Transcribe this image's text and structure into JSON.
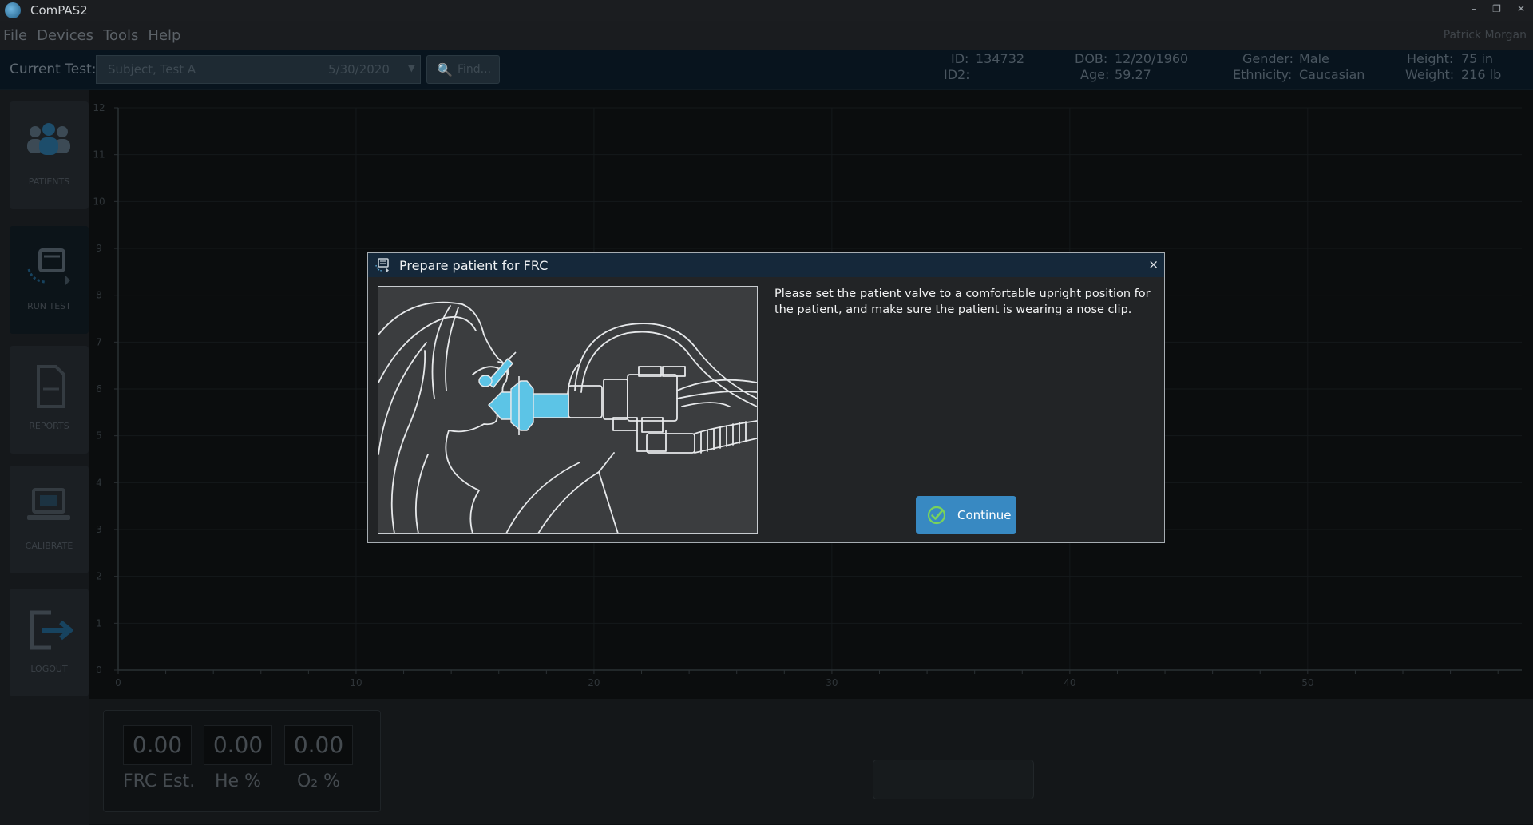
{
  "window": {
    "title": "ComPAS2",
    "controls": [
      "–",
      "❐",
      "✕"
    ]
  },
  "menu": {
    "items": [
      "File",
      "Devices",
      "Tools",
      "Help"
    ],
    "user": "Patrick Morgan"
  },
  "toolbar": {
    "current_test_label": "Current Test:",
    "test_name": "Subject, Test A",
    "test_date": "5/30/2020",
    "find_label": "Find..."
  },
  "patient": {
    "id_label": "ID:",
    "id": "134732",
    "id2_label": "ID2:",
    "id2": "",
    "dob_label": "DOB:",
    "dob": "12/20/1960",
    "age_label": "Age:",
    "age": "59.27",
    "gender_label": "Gender:",
    "gender": "Male",
    "ethnicity_label": "Ethnicity:",
    "ethnicity": "Caucasian",
    "height_label": "Height:",
    "height": "75 in",
    "weight_label": "Weight:",
    "weight": "216 lb"
  },
  "sidebar": {
    "items": [
      {
        "label": "PATIENTS",
        "icon": "patients-icon"
      },
      {
        "label": "RUN TEST",
        "icon": "run-test-icon"
      },
      {
        "label": "REPORTS",
        "icon": "reports-icon"
      },
      {
        "label": "CALIBRATE",
        "icon": "calibrate-icon"
      },
      {
        "label": "LOGOUT",
        "icon": "logout-icon"
      }
    ]
  },
  "chart_data": {
    "type": "line",
    "x_ticks": [
      "0",
      "10",
      "20",
      "30",
      "40",
      "50"
    ],
    "y_ticks": [
      "0",
      "1",
      "2",
      "3",
      "4",
      "5",
      "6",
      "7",
      "8",
      "9",
      "10",
      "11",
      "12"
    ],
    "xlim": [
      0,
      59
    ],
    "ylim": [
      0,
      12
    ],
    "grid": true,
    "series": []
  },
  "readouts": [
    {
      "value": "0.00",
      "label": "FRC Est."
    },
    {
      "value": "0.00",
      "label": "He %"
    },
    {
      "value": "0.00",
      "label": "O₂ %"
    }
  ],
  "dialog": {
    "title": "Prepare patient for FRC",
    "close": "×",
    "message": "Please set the patient valve to a comfortable upright position for the patient, and make sure the patient is wearing a nose clip.",
    "continue_label": "Continue",
    "colors": {
      "header": "#15283a",
      "accent": "#3889c2",
      "illustration_blue": "#5cc4e6"
    }
  }
}
